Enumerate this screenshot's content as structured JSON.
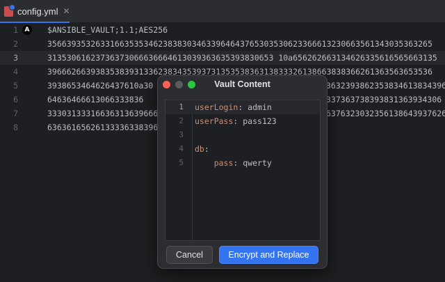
{
  "tab": {
    "filename": "config.yml",
    "close_glyph": "✕"
  },
  "editor": {
    "lines": [
      {
        "num": "1",
        "text": "$ANSIBLE_VAULT;1.1;AES256"
      },
      {
        "num": "2",
        "text": "35663935326331663535346238383034633964643765303530623366613230663561343035363265"
      },
      {
        "num": "3",
        "text": "31353061623736373066636664613039363635393830653 10a656262663134626335616565663135"
      },
      {
        "num": "4",
        "text": "39666266393835383931336238343539373135353836313833326138663838366261363563653536"
      },
      {
        "num": "5",
        "text": "3938653464626437610a30"
      },
      {
        "num": "6",
        "text": "64636466613066333836"
      },
      {
        "num": "7",
        "text": "33303133316636313639666"
      },
      {
        "num": "8",
        "text": "63636165626133336338396"
      }
    ],
    "ansible_badge": "A"
  },
  "overflow": {
    "line5": "36323938623538346138343965",
    "line6": "337363738393831363934306",
    "line7": "63763230323561386439376262"
  },
  "dialog": {
    "title": "Vault Content",
    "lines": [
      {
        "num": "1",
        "key": "userLogin",
        "sep": ": ",
        "value": "admin"
      },
      {
        "num": "2",
        "key": "userPass",
        "sep": ": ",
        "value": "pass123"
      },
      {
        "num": "3",
        "key": "",
        "sep": "",
        "value": ""
      },
      {
        "num": "4",
        "key": "db",
        "sep": ":",
        "value": ""
      },
      {
        "num": "5",
        "key": "    pass",
        "sep": ": ",
        "value": "qwerty"
      }
    ],
    "cancel_label": "Cancel",
    "primary_label": "Encrypt and Replace"
  },
  "colors": {
    "accent": "#3574f0",
    "key": "#cf8e6d"
  }
}
